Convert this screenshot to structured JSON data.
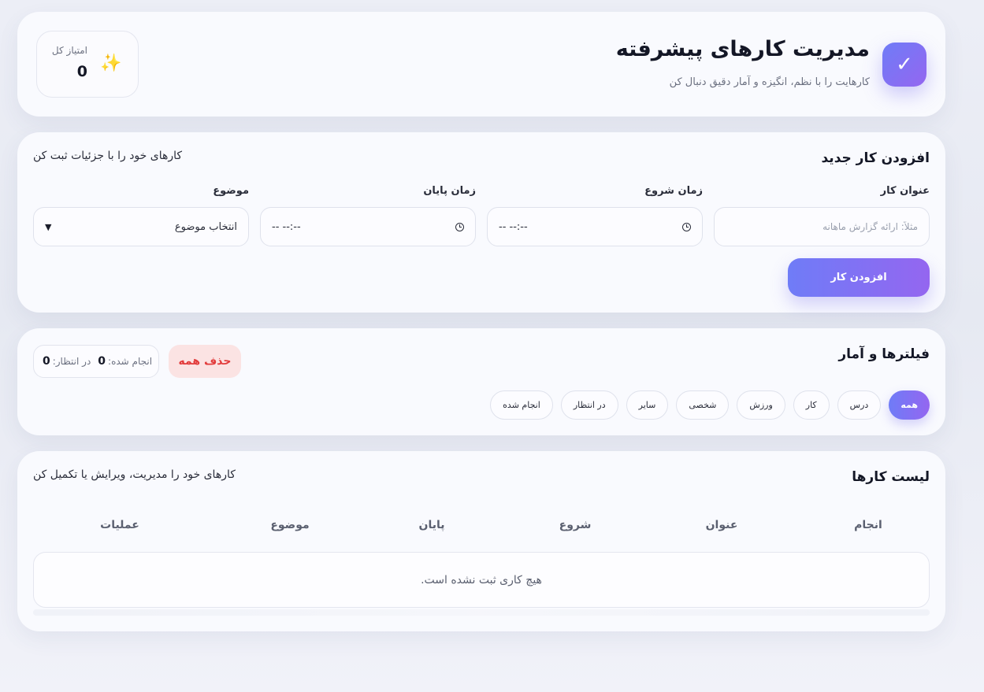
{
  "header": {
    "logo_glyph": "✓",
    "title": "مدیریت کارهای پیشرفته",
    "subtitle": "کارهایت را با نظم، انگیزه و آمار دقیق دنبال کن",
    "score_icon": "sparkles-icon",
    "score_label": "امتیاز کل",
    "score_value": "0"
  },
  "add_task": {
    "title": "افزودن کار جدید",
    "description": "کارهای خود را با جزئیات ثبت کن",
    "fields": {
      "title_label": "عنوان کار",
      "title_placeholder": "مثلاً: ارائه گزارش ماهانه",
      "start_label": "زمان شروع",
      "start_value": "-- --:--",
      "end_label": "زمان پایان",
      "end_value": "-- --:--",
      "topic_label": "موضوع",
      "topic_value": "انتخاب موضوع"
    },
    "add_button": "افزودن کار",
    "accent_colors": [
      "#6f7cf7",
      "#9466f0"
    ]
  },
  "filters": {
    "title": "فیلترها و آمار",
    "clear_all": "حذف همه",
    "clear_color": "#e23c3c",
    "stats": {
      "done_label": "انجام شده:",
      "done_value": "0",
      "pending_label": "در انتظار:",
      "pending_value": "0"
    },
    "chips": [
      {
        "label": "همه",
        "active": true
      },
      {
        "label": "درس",
        "active": false
      },
      {
        "label": "کار",
        "active": false
      },
      {
        "label": "ورزش",
        "active": false
      },
      {
        "label": "شخصی",
        "active": false
      },
      {
        "label": "سایر",
        "active": false
      },
      {
        "label": "در انتظار",
        "active": false
      },
      {
        "label": "انجام شده",
        "active": false
      }
    ]
  },
  "task_list": {
    "title": "لیست کارها",
    "description": "کارهای خود را مدیریت، ویرایش یا تکمیل کن",
    "columns": [
      "انجام",
      "عنوان",
      "شروع",
      "پایان",
      "موضوع",
      "عملیات"
    ],
    "empty_message": "هیچ کاری ثبت نشده است."
  }
}
